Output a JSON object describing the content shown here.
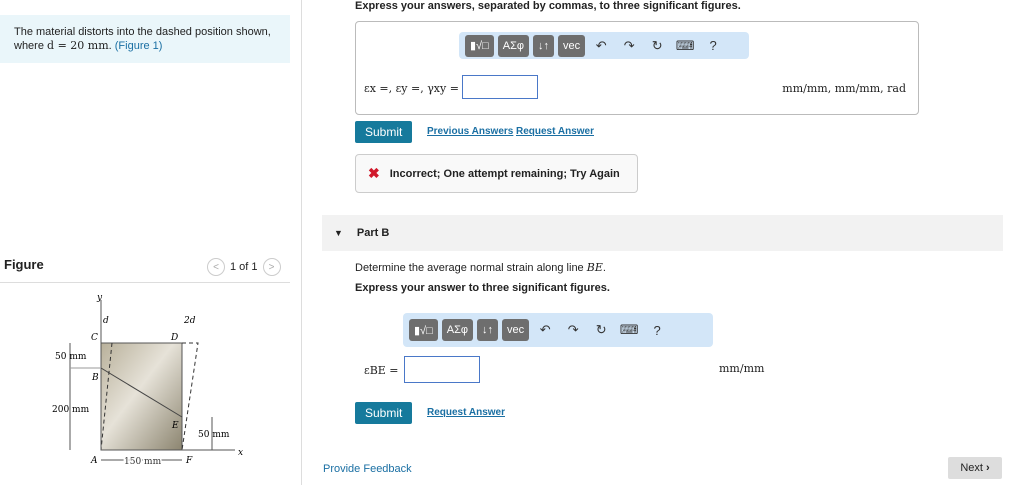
{
  "problem": {
    "text_before": "The material distorts into the dashed position shown, where ",
    "math": "d = 20 mm",
    "text_after": ". ",
    "figure_link": "(Figure 1)"
  },
  "figure": {
    "title": "Figure",
    "pager": "1 of 1",
    "labels": {
      "y": "y",
      "x": "x",
      "d": "d",
      "two_d": "2d",
      "A": "A",
      "B": "B",
      "C": "C",
      "D": "D",
      "E": "E",
      "F": "F",
      "dim50a": "50 mm",
      "dim200": "200 mm",
      "dim50b": "50 mm",
      "dim150": "150 mm"
    }
  },
  "partA": {
    "instruction": "Express your answers, separated by commas, to three significant figures.",
    "toolbar": [
      "▮√□",
      "ΑΣφ",
      "↓↑",
      "vec"
    ],
    "answer_label": "εx =, εy =, γxy =",
    "answer_value": "",
    "units": "mm/mm, mm/mm, rad",
    "submit": "Submit",
    "previous_answers": "Previous Answers",
    "request_answer": "Request Answer",
    "feedback": "Incorrect; One attempt remaining; Try Again"
  },
  "partB": {
    "title": "Part B",
    "question_before": "Determine the average normal strain along line ",
    "question_math": "BE",
    "question_after": ".",
    "instruction": "Express your answer to three significant figures.",
    "toolbar": [
      "▮√□",
      "ΑΣφ",
      "↓↑",
      "vec"
    ],
    "answer_label": "εBE =",
    "answer_value": "",
    "units": "mm/mm",
    "submit": "Submit",
    "request_answer": "Request Answer"
  },
  "footer": {
    "provide_feedback": "Provide Feedback",
    "next": "Next"
  }
}
